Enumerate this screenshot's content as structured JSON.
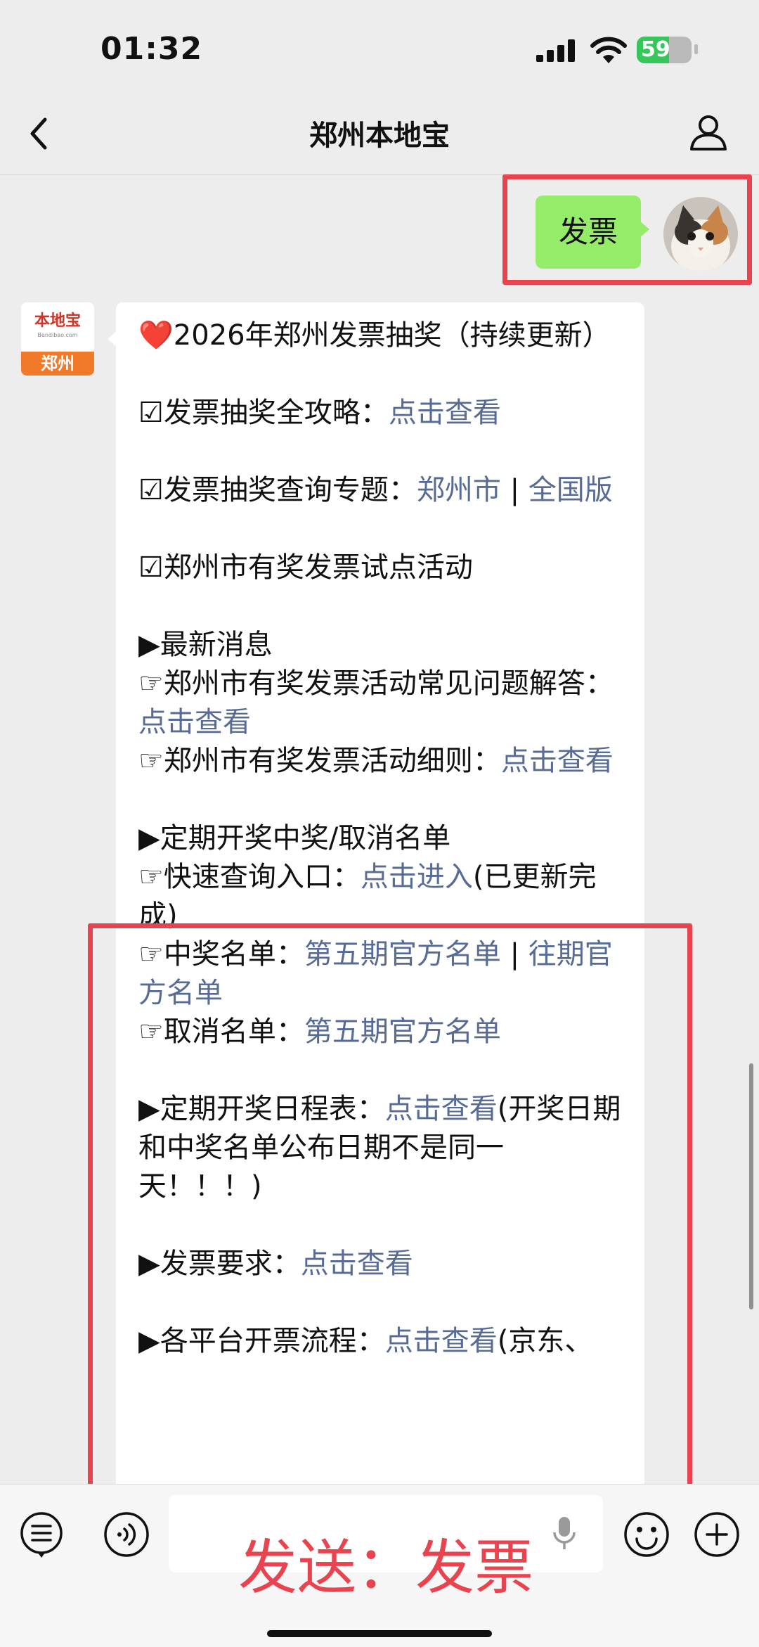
{
  "status": {
    "time": "01:32",
    "battery": "59",
    "battery_level": 0.59
  },
  "nav": {
    "title": "郑州本地宝"
  },
  "sent": {
    "text": "发票"
  },
  "received_avatar": {
    "name": "本地宝",
    "url": "Bendibao.com",
    "city": "郑州"
  },
  "message": {
    "lines": [
      "❤️2026年郑州发票抽奖（持续更新）",
      "",
      "☑发票抽奖全攻略：<a>点击查看</a>",
      "",
      "☑发票抽奖查询专题：<a>郑州市</a> | <a>全国版</a>",
      "",
      "☑郑州市有奖发票试点活动",
      "",
      "▶最新消息",
      "☞郑州市有奖发票活动常见问题解答：<a>点击查看</a>",
      "☞郑州市有奖发票活动细则：<a>点击查看</a>",
      "",
      "▶定期开奖中奖/取消名单",
      "☞快速查询入口：<a>点击进入</a>(已更新完成)",
      "☞中奖名单：<a>第五期官方名单</a> | <a>往期官方名单</a>",
      "☞取消名单：<a>第五期官方名单</a>",
      "",
      "▶定期开奖日程表：<a>点击查看</a>(开奖日期和中奖名单公布日期不是同一天！！！)",
      "",
      "▶发票要求：<a>点击查看</a>",
      "",
      "▶各平台开票流程：<a>点击查看</a>(京东、"
    ]
  },
  "overlay": {
    "caption": "发送：发票"
  },
  "icons": {
    "back": "chevron-left-icon",
    "user": "user-icon",
    "menu": "list-icon",
    "voice": "voice-icon",
    "mic": "mic-icon",
    "emoji": "emoji-icon",
    "plus": "plus-icon"
  },
  "colors": {
    "highlight": "#e8434e",
    "bubble_sent": "#95ec69",
    "link": "#576b95"
  }
}
